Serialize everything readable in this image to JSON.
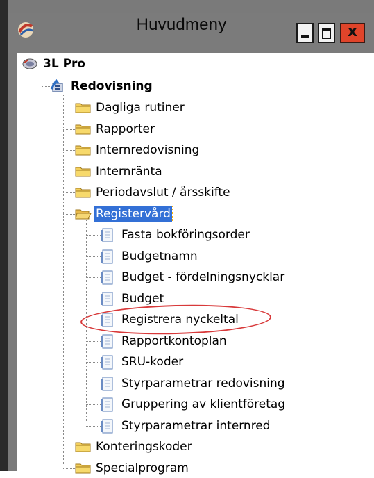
{
  "window": {
    "title": "Huvudmeny",
    "controls": {
      "minimize": "minimize",
      "maximize": "maximize",
      "close": "x"
    }
  },
  "tree": {
    "root": "3L Pro",
    "module": "Redovisning",
    "folders_before": [
      "Dagliga rutiner",
      "Rapporter",
      "Internredovisning",
      "Internränta",
      "Periodavslut / årsskifte"
    ],
    "selected_folder": "Registervård",
    "documents": [
      "Fasta bokföringsorder",
      "Budgetnamn",
      "Budget - fördelningsnycklar",
      "Budget",
      "Registrera nyckeltal",
      "Rapportkontoplan",
      "SRU-koder",
      "Styrparametrar redovisning",
      "Gruppering av klientföretag",
      "Styrparametrar internred"
    ],
    "folders_after": [
      "Konteringskoder",
      "Specialprogram"
    ]
  },
  "colors": {
    "selection": "#3370d6",
    "annotation": "#d8393a",
    "folder": "#f3cf5c"
  }
}
